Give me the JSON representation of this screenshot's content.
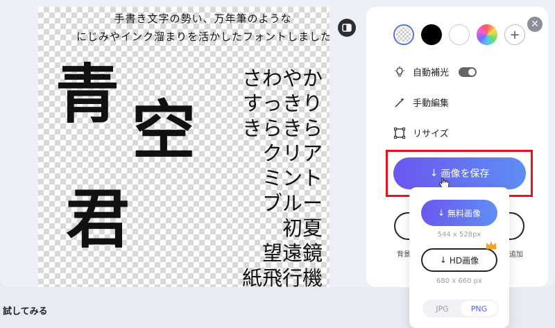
{
  "canvas": {
    "subtitle_line1": "手書き文字の勢い、万年筆のような",
    "subtitle_line2": "にじみやインク溜まりを活かしたフォントしました",
    "big_chars": [
      "青",
      "空",
      "君"
    ],
    "words": [
      "さわやか",
      "すっきり",
      "きらきら",
      "クリア",
      "ミント",
      "ブルー",
      "初夏",
      "望遠鏡",
      "紙飛行機"
    ]
  },
  "panel": {
    "swatches": [
      {
        "name": "transparent",
        "color": "transparent",
        "selected": true
      },
      {
        "name": "black",
        "color": "#000000"
      },
      {
        "name": "white",
        "color": "#ffffff"
      },
      {
        "name": "rainbow",
        "color": "conic"
      },
      {
        "name": "add",
        "color": "#ffffff"
      }
    ],
    "auto_label": "自動補光",
    "manual_label": "手動編集",
    "resize_label": "リサイズ",
    "save_label": "画像を保存",
    "left_hidden_label": "背景",
    "right_hidden_label": "追加"
  },
  "dropdown": {
    "free_label": "無料画像",
    "free_size": "544 x 528px",
    "hd_label": "HD画像",
    "hd_size": "680 x 660 px",
    "formats": [
      "JPG",
      "PNG"
    ],
    "selected_format": "PNG"
  },
  "footer": {
    "try_label": "試してみる"
  },
  "colors": {
    "accent": "#5f6ef2",
    "highlight": "#e8141b"
  }
}
